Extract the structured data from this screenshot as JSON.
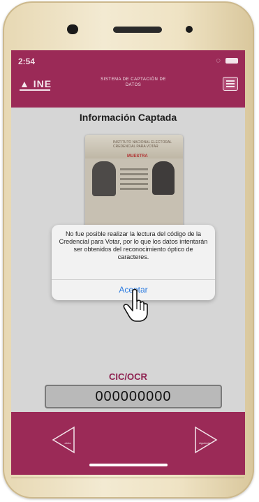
{
  "status_bar": {
    "time": "2:54"
  },
  "header": {
    "logo": "INE",
    "system_title": "SISTEMA DE CAPTACIÓN DE DATOS"
  },
  "page_title": "Información Captada",
  "card": {
    "watermark": "MUESTRA",
    "institution_text": "INSTITUTO NACIONAL ELECTORAL CREDENCIAL PARA VOTAR"
  },
  "dialog": {
    "message": "No fue posible realizar la lectura del código de la Credencial para Votar, por lo que los datos intentarán ser obtenidos del reconocimiento óptico de caracteres.",
    "accept_label": "Aceptar"
  },
  "cic": {
    "label": "CIC/OCR",
    "value": "000000000"
  },
  "nav": {
    "back_label": "atrás",
    "next_label": "siguiente"
  },
  "colors": {
    "brand": "#9b2a57",
    "dialog_button": "#2d7ce0",
    "background": "#d6d6d6"
  }
}
